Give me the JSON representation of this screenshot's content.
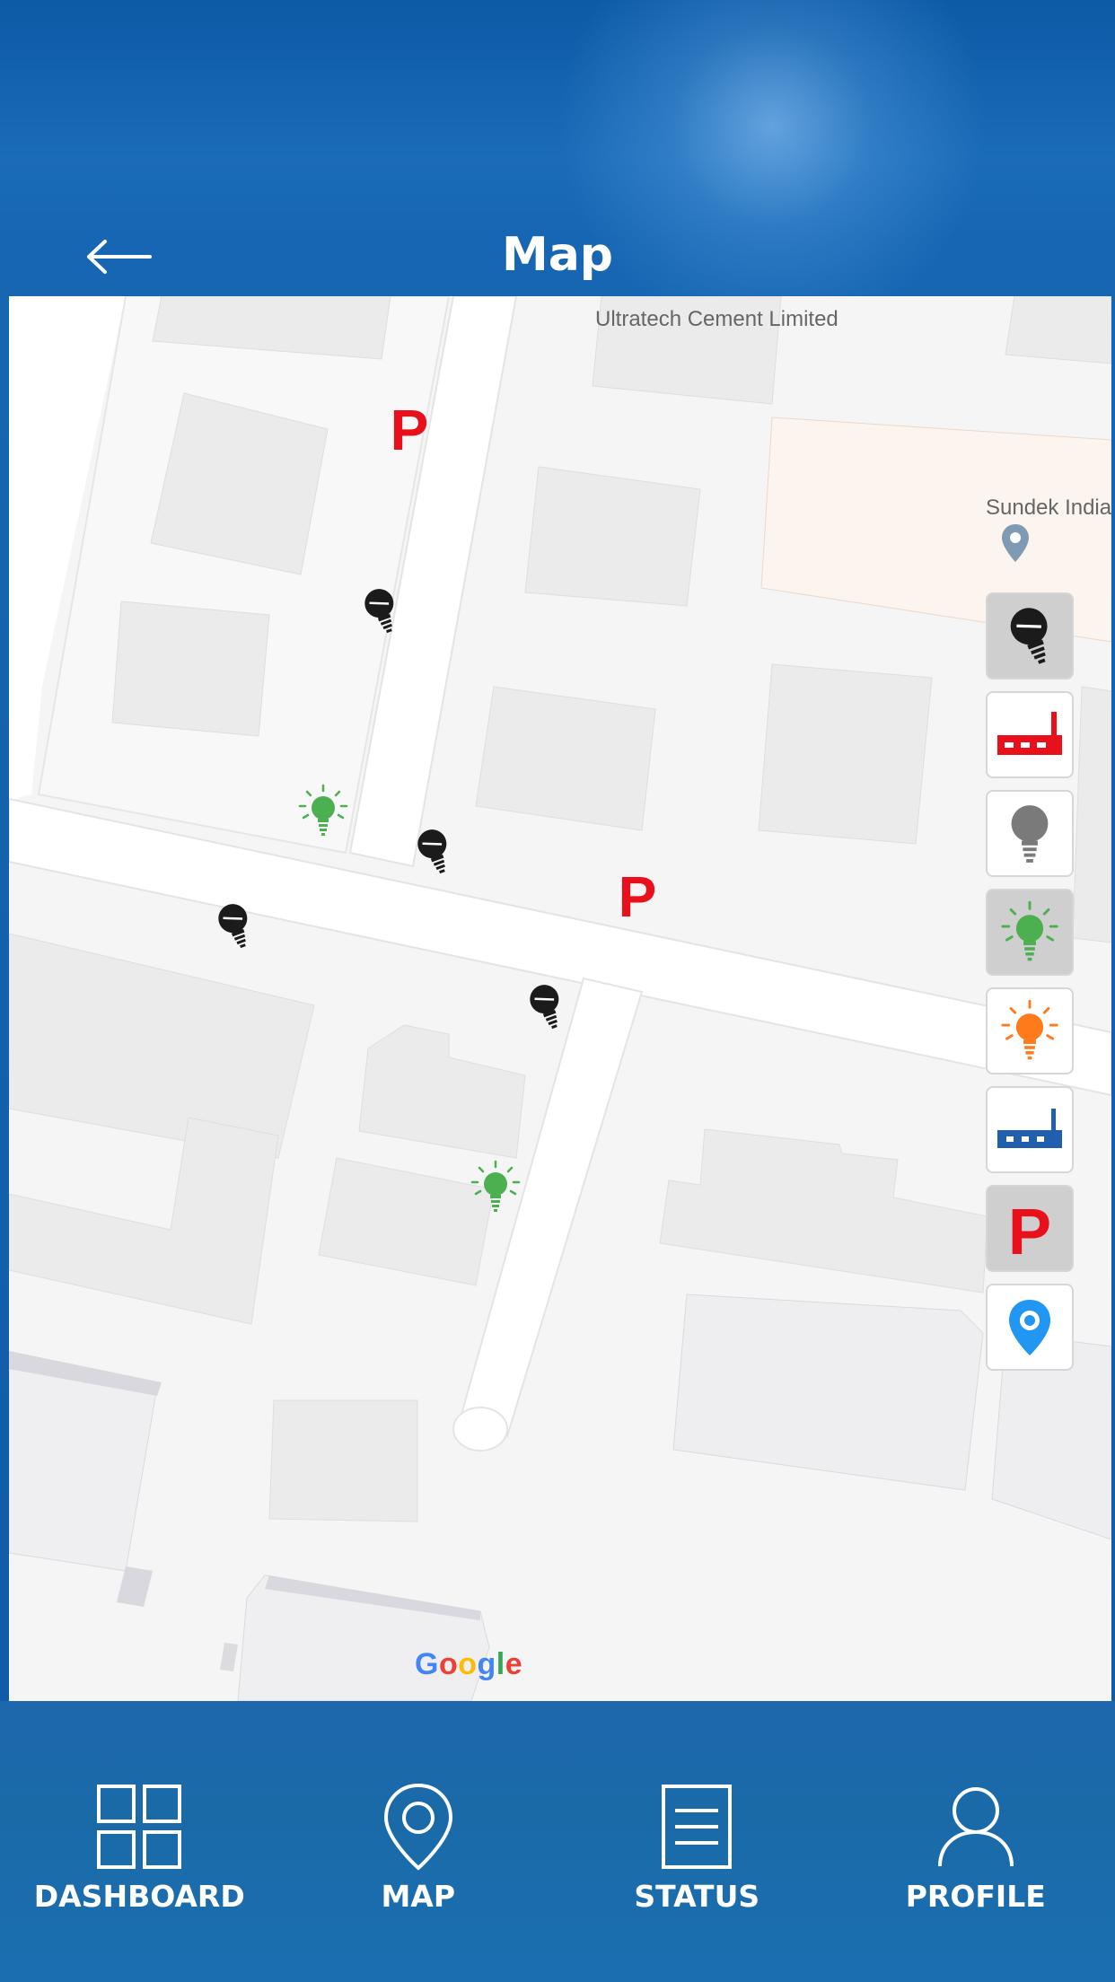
{
  "header": {
    "title": "Map"
  },
  "map": {
    "labels": {
      "ultratech": "Ultratech Cement Limited",
      "sundek": "Sundek India"
    },
    "attribution": "Google"
  },
  "legend": {
    "items": [
      {
        "name": "legend-light-off",
        "icon": "bulb-off-icon",
        "active": true
      },
      {
        "name": "legend-gateway-red",
        "icon": "router-red-icon",
        "active": false
      },
      {
        "name": "legend-light-grey",
        "icon": "bulb-grey-icon",
        "active": false
      },
      {
        "name": "legend-light-on",
        "icon": "bulb-green-icon",
        "active": true
      },
      {
        "name": "legend-light-orange",
        "icon": "bulb-orange-icon",
        "active": false
      },
      {
        "name": "legend-gateway-blue",
        "icon": "router-blue-icon",
        "active": false
      },
      {
        "name": "legend-parking",
        "icon": "parking-icon",
        "active": true
      },
      {
        "name": "legend-location",
        "icon": "location-pin-icon",
        "active": false
      }
    ]
  },
  "colors": {
    "header_bg": "#1666b3",
    "light_on": "#4caf50",
    "light_orange": "#ff7a1a",
    "parking_red": "#e8101a",
    "gateway_blue": "#1f5fad",
    "location_blue": "#2196f3"
  },
  "nav": {
    "dashboard": "DASHBOARD",
    "map": "MAP",
    "status": "STATUS",
    "profile": "PROFILE"
  }
}
